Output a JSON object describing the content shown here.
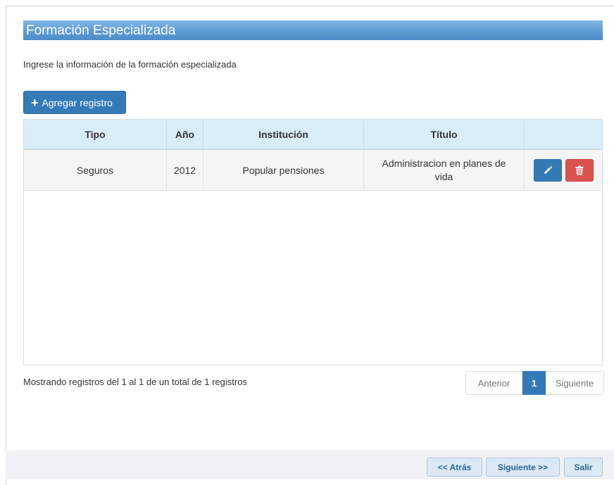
{
  "section": {
    "title": "Formación Especializada"
  },
  "intro_text": "Ingrese la información de la formación especializada",
  "add_button": {
    "icon": "plus-icon",
    "label": "Agregar registro"
  },
  "table": {
    "headers": [
      "Tipo",
      "Año",
      "Institución",
      "Título",
      ""
    ],
    "rows": [
      {
        "tipo": "Seguros",
        "anio": "2012",
        "institucion": "Popular pensiones",
        "titulo": "Administracion en planes de vida"
      }
    ],
    "row_actions": {
      "edit_icon": "pencil-icon",
      "delete_icon": "trash-icon"
    }
  },
  "pagination": {
    "info": "Mostrando registros del 1 al 1 de un total de 1 registros",
    "prev": "Anterior",
    "current": "1",
    "next": "Siguiente"
  },
  "footer": {
    "back": "<< Atrás",
    "next": "Siguiente >>",
    "exit": "Salir"
  },
  "colors": {
    "primary": "#337ab7",
    "danger": "#d9534f",
    "header_bg": "#d9edf7",
    "title_bar": "#5d9bd3"
  }
}
